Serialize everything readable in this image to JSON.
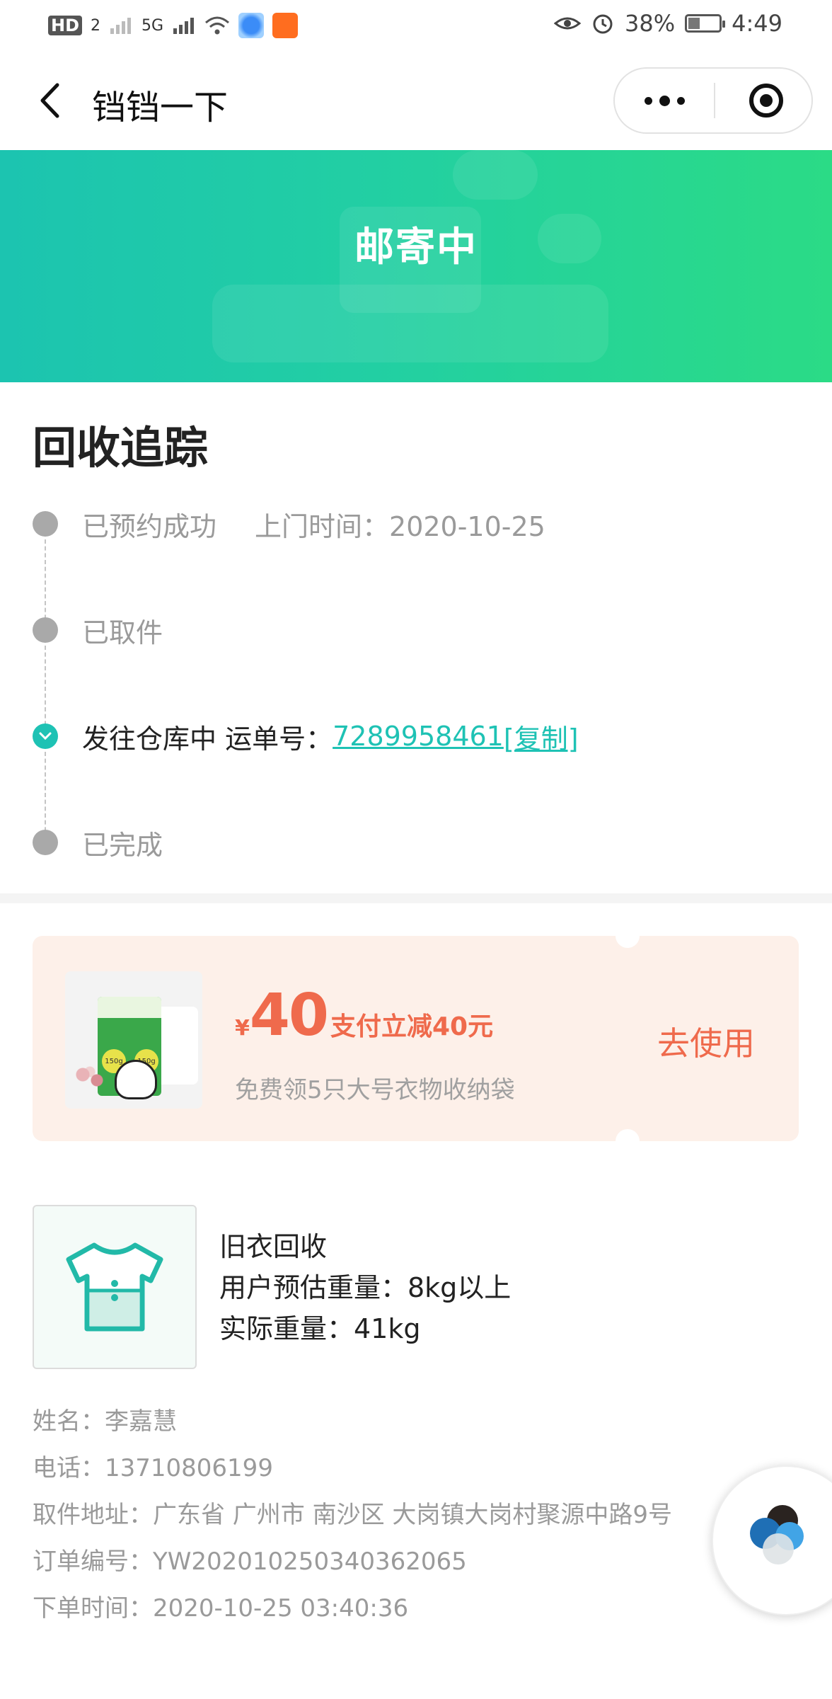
{
  "status_bar": {
    "left_labels": [
      "HD",
      "2",
      "5G"
    ],
    "battery": "38%",
    "battery_level": 0.38,
    "time": "4:49"
  },
  "nav": {
    "title": "铛铛一下",
    "icons": [
      "back-icon",
      "more-icon",
      "close-capsule-icon"
    ]
  },
  "banner": {
    "status_title": "邮寄中",
    "gradient_colors": [
      "#1cc4b0",
      "#2bdb86"
    ]
  },
  "tracking": {
    "title": "回收追踪",
    "steps": [
      {
        "label": "已预约成功",
        "extra": "上门时间：2020-10-25",
        "active": false
      },
      {
        "label": "已取件",
        "extra": "",
        "active": false
      },
      {
        "label": "发往仓库中 运单号：",
        "tracking_number": "7289958461",
        "copy_label": "[复制]",
        "active": true
      },
      {
        "label": "已完成",
        "extra": "",
        "active": false
      }
    ],
    "accent_color": "#1ec2b4"
  },
  "coupon": {
    "currency": "¥",
    "amount": "40",
    "desc": "支付立减40元",
    "subtitle": "免费领5只大号衣物收纳袋",
    "button_label": "去使用",
    "image_labels": [
      "150g",
      "150g"
    ],
    "accent_color": "#ef6a4c",
    "background_color": "#fdf0e9"
  },
  "product": {
    "name": "旧衣回收",
    "estimated_weight": "用户预估重量：8kg以上",
    "actual_weight": "实际重量：41kg",
    "icon": "tshirt-icon"
  },
  "order": {
    "name": "姓名：李嘉慧",
    "phone": "电话：13710806199",
    "address": "取件地址：广东省 广州市 南沙区 大岗镇大岗村聚源中路9号",
    "order_number": "订单编号：YW202010250340362065",
    "order_time": "下单时间：2020-10-25 03:40:36"
  },
  "float_button": {
    "icon": "assistant-logo-icon"
  }
}
